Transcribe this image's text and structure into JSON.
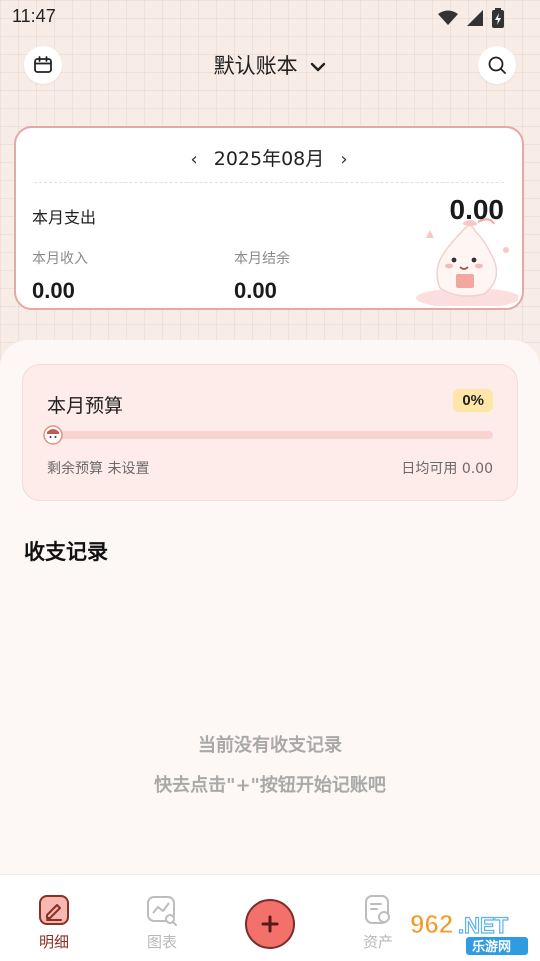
{
  "status_bar": {
    "time": "11:47"
  },
  "header": {
    "title": "默认账本"
  },
  "month_card": {
    "month": "2025年08月",
    "expense_label": "本月支出",
    "expense_value": "0.00",
    "income_label": "本月收入",
    "income_value": "0.00",
    "balance_label": "本月结余",
    "balance_value": "0.00"
  },
  "budget": {
    "title": "本月预算",
    "percent_label": "0%",
    "progress": 0,
    "remaining": "剩余预算 未设置",
    "daily": "日均可用 0.00"
  },
  "records": {
    "title": "收支记录",
    "empty_line1": "当前没有收支记录",
    "empty_line2": "快去点击\"+\"按钮开始记账吧"
  },
  "bottom_nav": {
    "items": [
      {
        "label": "明细"
      },
      {
        "label": "图表"
      },
      {
        "label": "资产"
      }
    ]
  },
  "watermark": {
    "text": "962.NET",
    "subtext": "乐游网"
  },
  "colors": {
    "accent": "#e88f86",
    "nav_active": "#8b2e24",
    "nav_inactive": "#b9b9b9",
    "add_button": "#f2716b"
  }
}
